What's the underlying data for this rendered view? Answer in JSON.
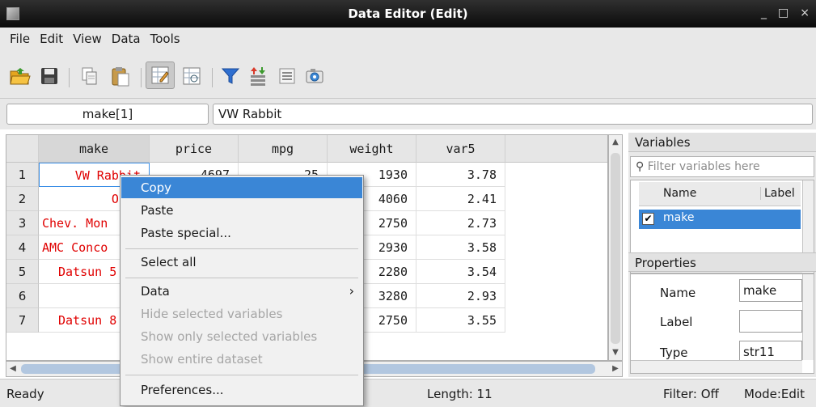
{
  "window": {
    "title": "Data Editor (Edit)",
    "icon": "stata-app-icon",
    "controls": [
      "_",
      "□",
      "×"
    ]
  },
  "menubar": [
    "File",
    "Edit",
    "View",
    "Data",
    "Tools"
  ],
  "toolbar": {
    "buttons": [
      "open-icon",
      "save-icon",
      "copy-icon",
      "paste-icon",
      "edit-mode-icon",
      "browse-mode-icon",
      "filter-icon",
      "variable-manager-icon",
      "properties-icon",
      "snapshot-icon"
    ],
    "active": "edit-mode-icon"
  },
  "address": {
    "cell_ref": "make[1]",
    "cell_value": "VW Rabbit"
  },
  "grid": {
    "columns": [
      "make",
      "price",
      "mpg",
      "weight",
      "var5"
    ],
    "rows": [
      {
        "n": "1",
        "make": "VW Rabbit",
        "price": "4697",
        "mpg": "25",
        "weight": "1930",
        "var5": "3.78"
      },
      {
        "n": "2",
        "make": "Olds",
        "price": "",
        "mpg": "",
        "weight": "4060",
        "var5": "2.41"
      },
      {
        "n": "3",
        "make": "Chev. Mon",
        "price": "",
        "mpg": "",
        "weight": "2750",
        "var5": "2.73"
      },
      {
        "n": "4",
        "make": "AMC Conco",
        "price": "",
        "mpg": "",
        "weight": "2930",
        "var5": "3.58"
      },
      {
        "n": "5",
        "make": "Datsun 5",
        "price": "",
        "mpg": "",
        "weight": "2280",
        "var5": "3.54"
      },
      {
        "n": "6",
        "make": "",
        "price": "",
        "mpg": "",
        "weight": "3280",
        "var5": "2.93"
      },
      {
        "n": "7",
        "make": "Datsun 8",
        "price": "",
        "mpg": "",
        "weight": "2750",
        "var5": "3.55"
      }
    ]
  },
  "context_menu": {
    "copy": "Copy",
    "paste": "Paste",
    "paste_special": "Paste special...",
    "select_all": "Select all",
    "data": "Data",
    "submenu_arrow": "›",
    "hide_selected": "Hide selected variables",
    "show_only_selected": "Show only selected variables",
    "show_entire": "Show entire dataset",
    "preferences": "Preferences..."
  },
  "variables_panel": {
    "title": "Variables",
    "filter_placeholder": "Filter variables here",
    "col_name": "Name",
    "col_label": "Label",
    "items": [
      {
        "name": "make",
        "checked": true
      }
    ]
  },
  "properties_panel": {
    "title": "Properties",
    "name_label": "Name",
    "name_value": "make",
    "label_label": "Label",
    "label_value": "",
    "type_label": "Type",
    "type_value": "str11"
  },
  "status": {
    "left": "Ready",
    "length": "Length: 11",
    "filter": "Filter: Off",
    "mode": "Mode:Edit"
  },
  "colors": {
    "selection": "#3a86d6",
    "string_text": "#e00000",
    "titlebar": "#1a1a1a"
  }
}
